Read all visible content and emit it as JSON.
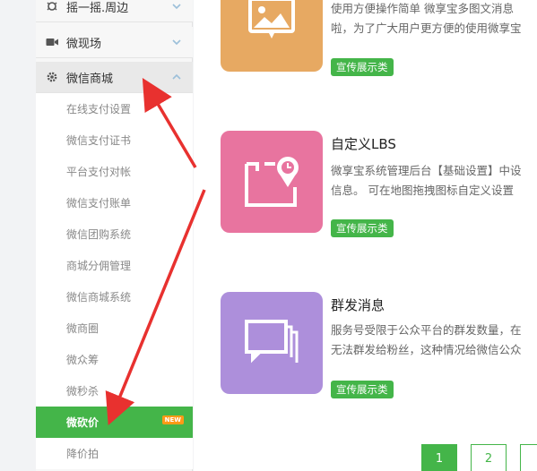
{
  "sidebar": {
    "sections": [
      {
        "label": "摇一摇.周边",
        "icon": "shake-icon"
      },
      {
        "label": "微现场",
        "icon": "video-camera-icon"
      },
      {
        "label": "微信商城",
        "icon": "gear-icon"
      }
    ],
    "items": [
      {
        "label": "在线支付设置"
      },
      {
        "label": "微信支付证书"
      },
      {
        "label": "平台支付对帐"
      },
      {
        "label": "微信支付账单"
      },
      {
        "label": "微信团购系统"
      },
      {
        "label": "商城分佣管理"
      },
      {
        "label": "微信商城系统"
      },
      {
        "label": "微商圈"
      },
      {
        "label": "微众筹"
      },
      {
        "label": "微秒杀"
      },
      {
        "label": "微砍价",
        "badge": "NEW"
      },
      {
        "label": "降价拍"
      }
    ]
  },
  "cards": [
    {
      "title": "",
      "desc_line1": "使用方便操作简单 微享宝多图文消息",
      "desc_line2": "啦，为了广大用户更方便的使用微享宝",
      "tag": "宣传展示类",
      "color": "#e7a962",
      "icon": "image-message-icon"
    },
    {
      "title": "自定义LBS",
      "desc_line1": "微享宝系统管理后台【基础设置】中设",
      "desc_line2": "信息。 可在地图拖拽图标自定义设置",
      "tag": "宣传展示类",
      "color": "#e8749f",
      "icon": "location-map-icon"
    },
    {
      "title": "群发消息",
      "desc_line1": "服务号受限于公众平台的群发数量，在",
      "desc_line2": "无法群发给粉丝，这种情况给微信公众",
      "tag": "宣传展示类",
      "color": "#ad8fdb",
      "icon": "mass-message-icon"
    }
  ],
  "pagination": {
    "pages": [
      "1",
      "2"
    ],
    "current": "1"
  },
  "colors": {
    "accent": "#44b549",
    "badge": "#ff9a16",
    "arrow": "#e8312f"
  }
}
